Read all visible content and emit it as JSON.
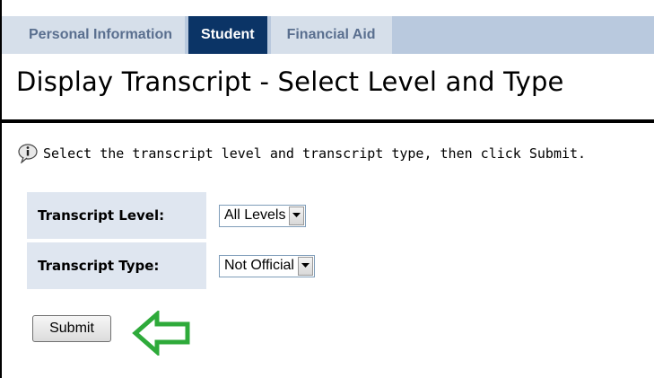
{
  "tabs": [
    {
      "label": "Personal Information",
      "active": false
    },
    {
      "label": "Student",
      "active": true
    },
    {
      "label": "Financial Aid",
      "active": false
    }
  ],
  "page": {
    "title": "Display Transcript - Select Level and Type",
    "instruction": "Select the transcript level and transcript type, then click Submit."
  },
  "form": {
    "level_label": "Transcript Level:",
    "level_value": "All Levels",
    "type_label": "Transcript Type:",
    "type_value": "Not Official",
    "submit_label": "Submit"
  },
  "icons": {
    "info": "info-speech-icon",
    "dropdown": "chevron-down-icon",
    "pointer": "arrow-left-icon"
  },
  "colors": {
    "tabbar_bg": "#b9c9de",
    "tab_active_bg": "#0b3466",
    "tab_inactive_text": "#5a6f8f",
    "label_bg": "#dfe6f0",
    "pointer_arrow": "#2eaa3a"
  }
}
